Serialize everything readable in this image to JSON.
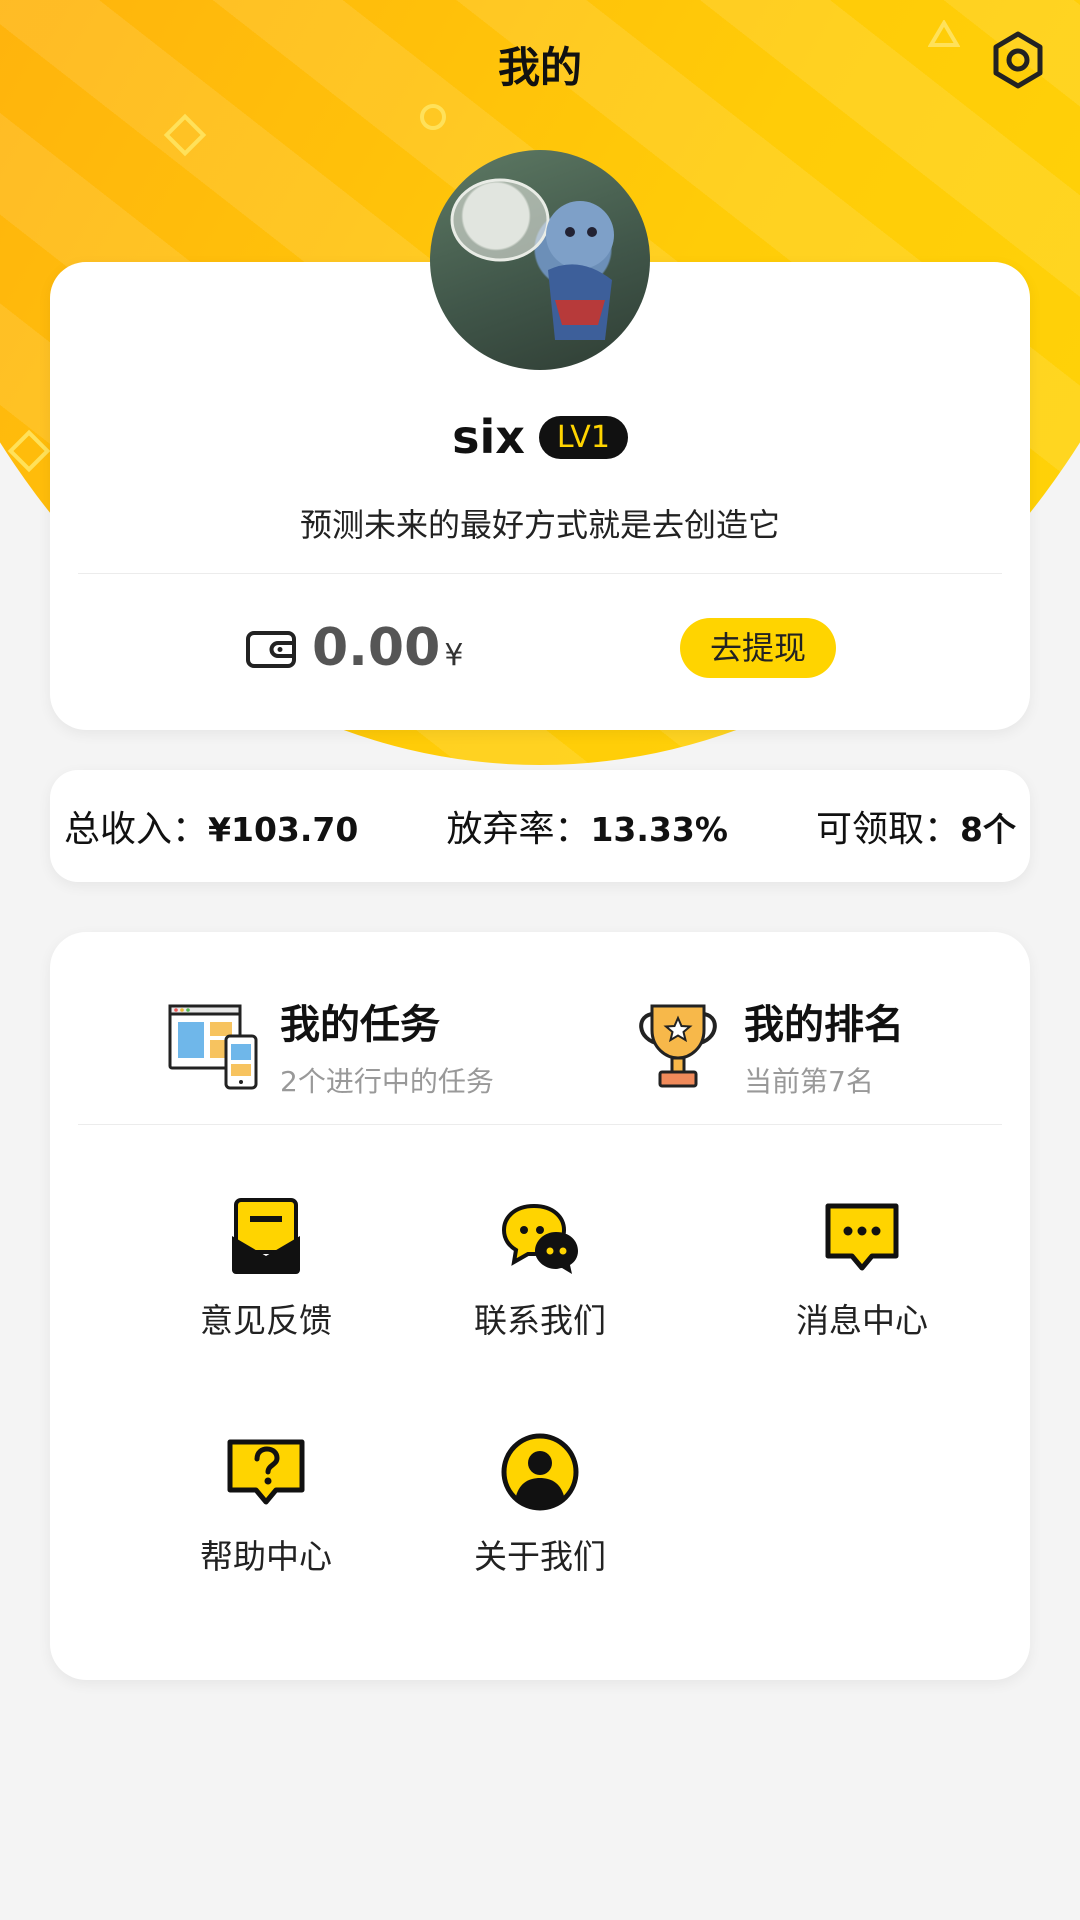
{
  "header": {
    "title": "我的"
  },
  "profile": {
    "username": "six",
    "level": "LV1",
    "motto": "预测未来的最好方式就是去创造它",
    "balance": "0.00",
    "currency": "¥",
    "withdraw_label": "去提现"
  },
  "stats": [
    {
      "label": "总收入：",
      "value": "¥103.70"
    },
    {
      "label": "放弃率：",
      "value": "13.33%"
    },
    {
      "label": "可领取：",
      "value": "8个"
    }
  ],
  "features": {
    "tasks": {
      "title": "我的任务",
      "subtitle": "2个进行中的任务"
    },
    "ranking": {
      "title": "我的排名",
      "subtitle": "当前第7名"
    }
  },
  "menu": [
    {
      "label": "意见反馈",
      "icon": "envelope-icon"
    },
    {
      "label": "联系我们",
      "icon": "chat-bubbles-icon"
    },
    {
      "label": "消息中心",
      "icon": "message-icon"
    },
    {
      "label": "帮助中心",
      "icon": "help-icon"
    },
    {
      "label": "关于我们",
      "icon": "user-circle-icon"
    }
  ],
  "colors": {
    "accent": "#ffd400",
    "orange": "#f08a2e",
    "background": "#f4f4f4"
  }
}
